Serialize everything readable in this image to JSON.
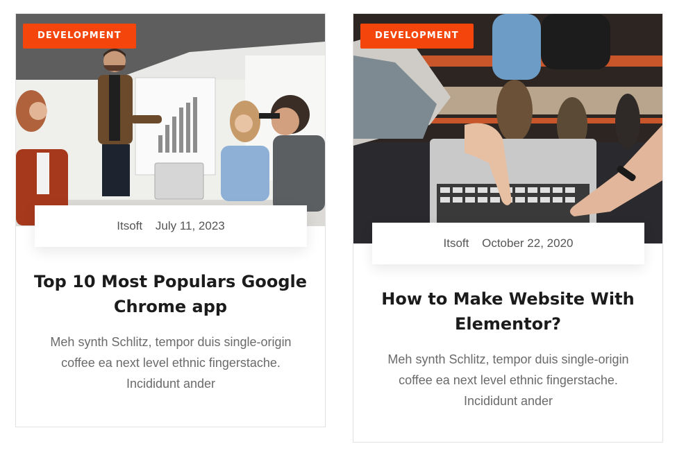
{
  "colors": {
    "accent": "#f4450d",
    "title": "#1b1b1b",
    "text": "#6a6a6a",
    "border": "#e2e2e2"
  },
  "posts": [
    {
      "category": "DEVELOPMENT",
      "author": "Itsoft",
      "date": "July 11, 2023",
      "title": "Top 10 Most Populars Google Chrome app",
      "excerpt": "Meh synth Schlitz, tempor duis single-origin coffee ea next level ethnic fingerstache. Incididunt ander",
      "image": "office-presentation-photo"
    },
    {
      "category": "DEVELOPMENT",
      "author": "Itsoft",
      "date": "October 22, 2020",
      "title": "How to Make Website With Elementor?",
      "excerpt": "Meh synth Schlitz, tempor duis single-origin coffee ea next level ethnic fingerstache. Incididunt ander",
      "image": "team-laptop-photo"
    }
  ]
}
